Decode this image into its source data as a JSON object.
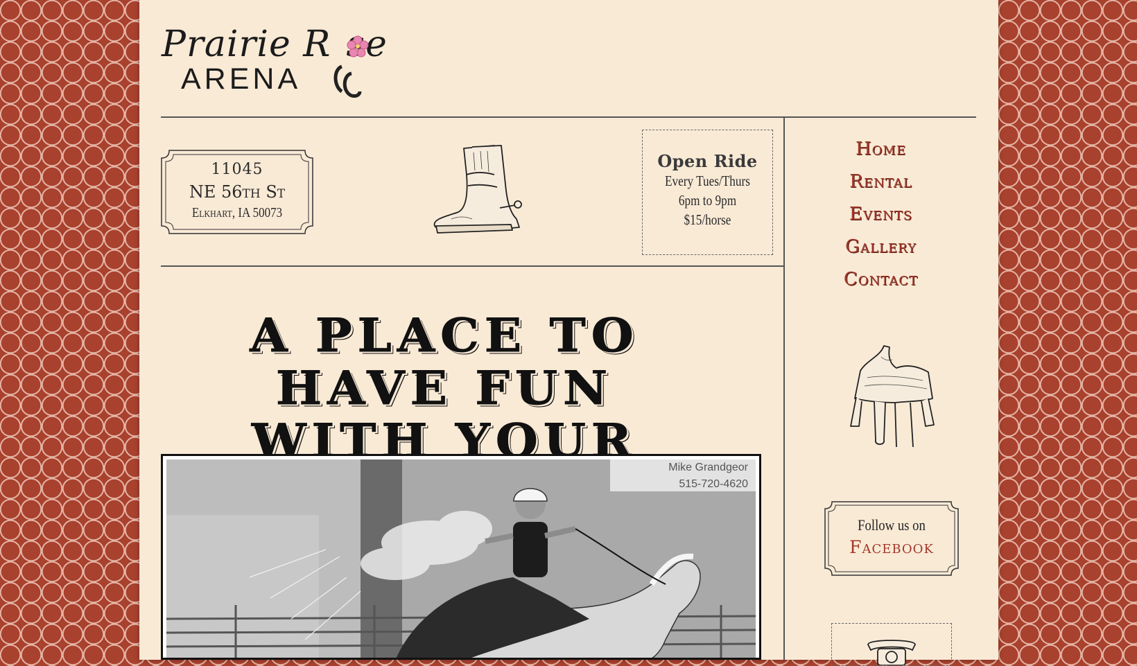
{
  "logo": {
    "line1": "Prairie R",
    "line1_end": "se",
    "line2": "ARENA"
  },
  "address": {
    "number": "11045",
    "street": "NE 56th St",
    "city": "Elkhart, IA 50073"
  },
  "open_ride": {
    "title": "Open Ride",
    "days": "Every Tues/Thurs",
    "hours": "6pm to 9pm",
    "price": "$15/horse"
  },
  "headline": {
    "line1": "A PLACE TO HAVE FUN",
    "line2": "WITH YOUR HORSE"
  },
  "nav": {
    "items": [
      {
        "label": "Home"
      },
      {
        "label": "Rental"
      },
      {
        "label": "Events"
      },
      {
        "label": "Gallery"
      },
      {
        "label": "Contact"
      }
    ]
  },
  "facebook": {
    "line1": "Follow us on",
    "line2": "Facebook"
  },
  "photo": {
    "sign_name": "Mike Grandgeor",
    "sign_phone": "515-720-4620"
  },
  "colors": {
    "accent": "#a3382a",
    "page_bg": "#f9ead6",
    "pattern_bg": "#a8412e"
  }
}
